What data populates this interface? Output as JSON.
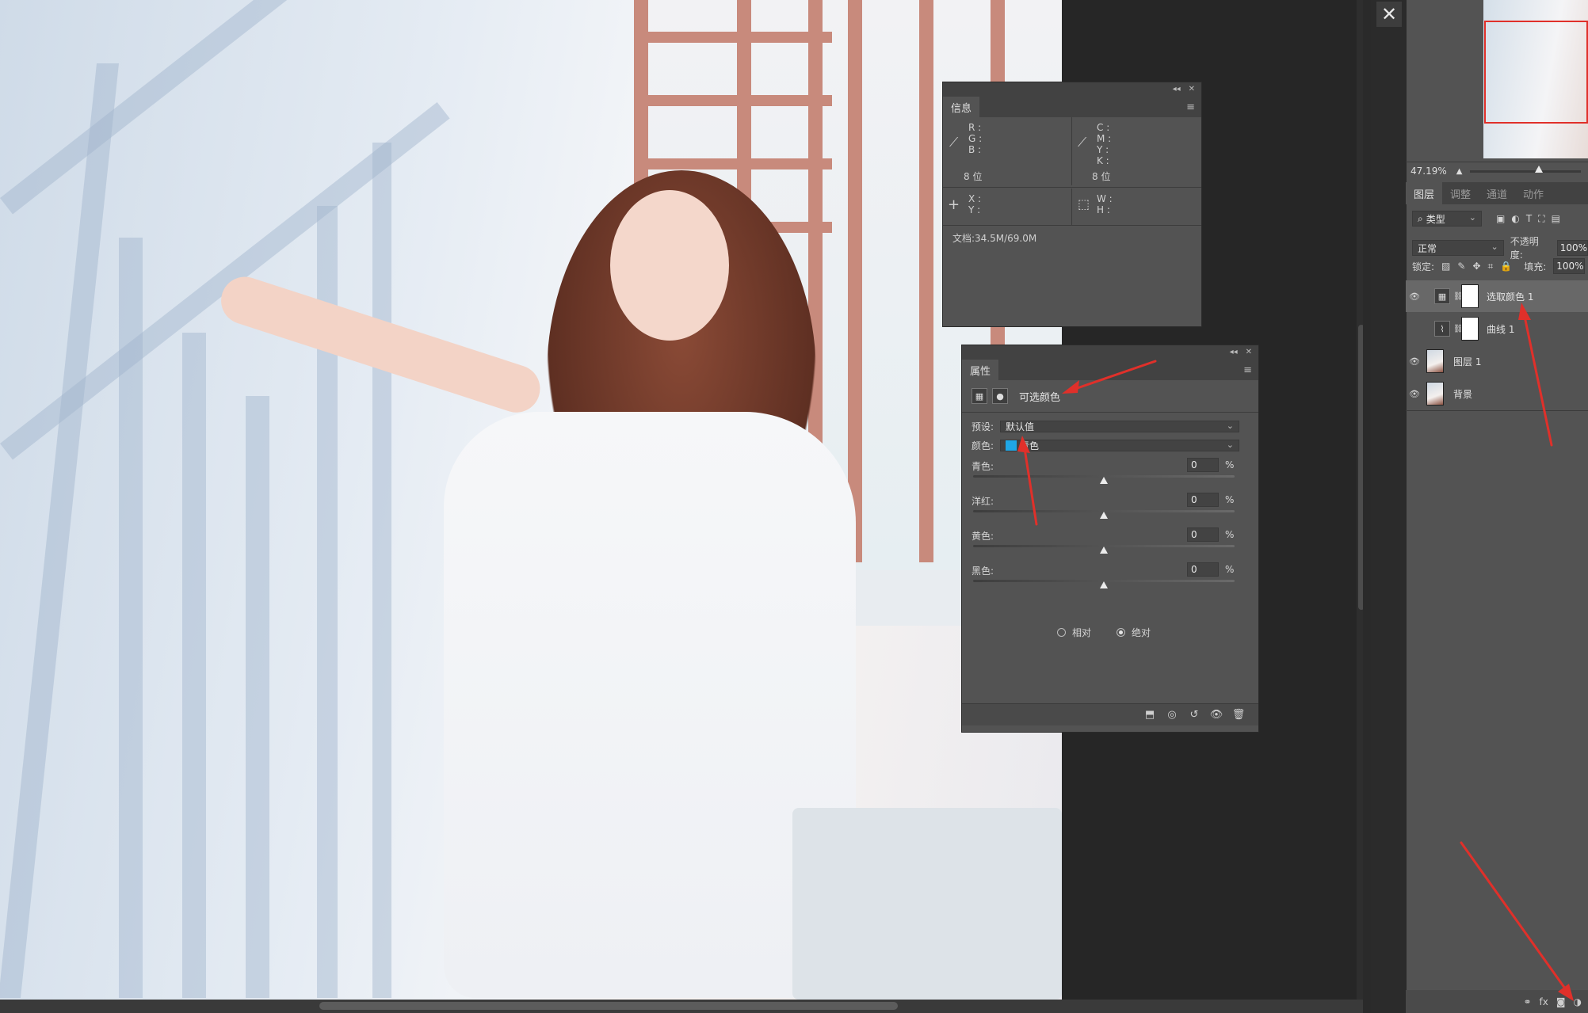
{
  "info_panel": {
    "tab": "信息",
    "rgb_labels": [
      "R :",
      "G :",
      "B :"
    ],
    "cmyk_labels": [
      "C :",
      "M :",
      "Y :",
      "K :"
    ],
    "bit_left": "8 位",
    "bit_right": "8 位",
    "xy_labels": [
      "X :",
      "Y :"
    ],
    "wh_labels": [
      "W :",
      "H :"
    ],
    "doc": "文档:34.5M/69.0M"
  },
  "properties_panel": {
    "tab": "属性",
    "adjustment_title": "可选颜色",
    "preset_label": "预设:",
    "preset_value": "默认值",
    "color_label": "颜色:",
    "color_value": "青色",
    "color_swatch": "#1fa7e6",
    "sliders": [
      {
        "label": "青色:",
        "value": "0",
        "unit": "%",
        "level": 0
      },
      {
        "label": "洋红:",
        "value": "0",
        "unit": "%",
        "level": 0
      },
      {
        "label": "黄色:",
        "value": "0",
        "unit": "%",
        "level": 0
      },
      {
        "label": "黑色:",
        "value": "0",
        "unit": "%",
        "level": 0
      }
    ],
    "radio_relative": "相对",
    "radio_absolute": "绝对",
    "selected_mode": "绝对"
  },
  "navigator": {
    "zoom": "47.19%"
  },
  "layers_panel": {
    "tabs": [
      "图层",
      "调整",
      "通道",
      "动作"
    ],
    "active_tab": "图层",
    "filter_kind": "类型",
    "blend_mode": "正常",
    "opacity_label": "不透明度:",
    "opacity_value": "100%",
    "lock_label": "锁定:",
    "fill_label": "填充:",
    "fill_value": "100%",
    "layers": [
      {
        "name": "选取颜色 1",
        "visible": true,
        "type": "adjustment",
        "selected": true
      },
      {
        "name": "曲线 1",
        "visible": false,
        "type": "adjustment",
        "selected": false
      },
      {
        "name": "图层 1",
        "visible": true,
        "type": "image",
        "selected": false
      },
      {
        "name": "背景",
        "visible": true,
        "type": "image",
        "selected": false
      }
    ]
  },
  "colors": {
    "annotation_arrow": "#e0302a",
    "panel_bg": "#535353",
    "panel_header": "#424242"
  }
}
